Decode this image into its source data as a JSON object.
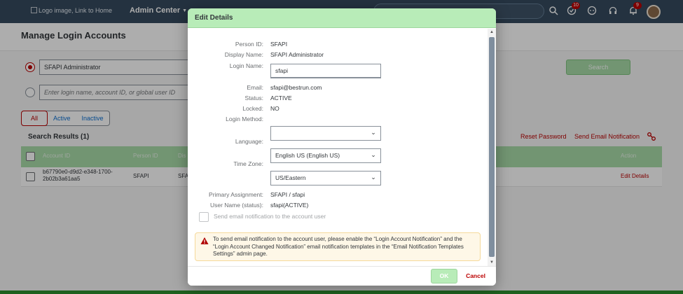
{
  "shell": {
    "logo_alt": "Logo image, Link to Home",
    "app_title": "Admin Center",
    "badges": {
      "todo": "10",
      "notifications": "9"
    }
  },
  "page": {
    "title": "Manage Login Accounts",
    "search_value": "SFAPI Administrator",
    "search_placeholder": "Enter login name, account ID, or global user ID",
    "search_button": "Search",
    "filters": {
      "all": "All",
      "active": "Active",
      "inactive": "Inactive"
    },
    "results_title": "Search Results (1)",
    "reset_password": "Reset Password",
    "send_email_notification": "Send Email Notification",
    "columns": {
      "account_id": "Account ID",
      "person_id": "Person ID",
      "display": "Dis",
      "action": "Action"
    },
    "rows": [
      {
        "account_id_line1": "b67790e0-d9d2-e348-1700-",
        "account_id_line2": "2b02b3a61aa5",
        "person_id": "SFAPI",
        "display": "SFA",
        "action": "Edit Details"
      }
    ]
  },
  "dialog": {
    "title": "Edit Details",
    "fields": {
      "person_id": {
        "label": "Person ID:",
        "value": "SFAPI"
      },
      "display_name": {
        "label": "Display Name:",
        "value": "SFAPI Administrator"
      },
      "login_name": {
        "label": "Login Name:",
        "value": "sfapi"
      },
      "email": {
        "label": "Email:",
        "value": "sfapi@bestrun.com"
      },
      "status": {
        "label": "Status:",
        "value": "ACTIVE"
      },
      "locked": {
        "label": "Locked:",
        "value": "NO"
      },
      "login_method": {
        "label": "Login Method:",
        "value": ""
      },
      "language": {
        "label": "Language:",
        "value": "English US (English US)"
      },
      "time_zone": {
        "label": "Time Zone:",
        "value": "US/Eastern"
      },
      "primary_assignment": {
        "label": "Primary Assignment:",
        "value": "SFAPI / sfapi"
      },
      "user_name": {
        "label": "User Name (status):",
        "value": "sfapi(ACTIVE)"
      }
    },
    "send_email_checkbox_label": "Send email notification to the account user",
    "message": "To send email notification to the account user, please enable the “Login Account Notification” and the “Login Account Changed Notification” email notification templates in the “Email Notification Templates Settings” admin page.",
    "ok_label": "OK",
    "cancel_label": "Cancel"
  },
  "colors": {
    "accent_red": "#bb0000",
    "dialog_header": "#b8ecb8",
    "shell": "#354a5f",
    "link_blue": "#0a6ed1"
  }
}
